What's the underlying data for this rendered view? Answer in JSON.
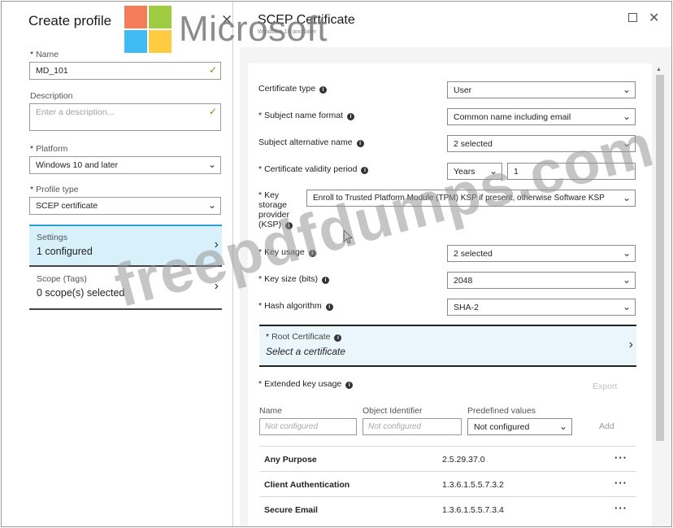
{
  "left_panel": {
    "title": "Create profile",
    "close_icon": "close-icon",
    "name": {
      "label": "Name",
      "value": "MD_101"
    },
    "description": {
      "label": "Description",
      "placeholder": "Enter a description..."
    },
    "platform": {
      "label": "Platform",
      "value": "Windows 10 and later"
    },
    "profile_type": {
      "label": "Profile type",
      "value": "SCEP certificate"
    },
    "settings": {
      "title": "Settings",
      "value": "1 configured"
    },
    "scope": {
      "title": "Scope (Tags)",
      "value": "0 scope(s) selected"
    }
  },
  "right_panel": {
    "title": "SCEP Certificate",
    "subtitle": "Windows 10 and later",
    "fields": {
      "certificate_type": {
        "label": "Certificate type",
        "value": "User"
      },
      "subject_name_format": {
        "label": "Subject name format",
        "value": "Common name including email"
      },
      "subject_alt_name": {
        "label": "Subject alternative name",
        "value": "2 selected"
      },
      "validity_period": {
        "label": "Certificate validity period",
        "unit": "Years",
        "value": "1"
      },
      "ksp": {
        "label_lines": [
          "Key",
          "storage",
          "provider",
          "(KSP)"
        ],
        "value": "Enroll to Trusted Platform Module (TPM) KSP if present, otherwise Software KSP"
      },
      "key_usage": {
        "label": "Key usage",
        "value": "2 selected"
      },
      "key_size": {
        "label": "Key size (bits)",
        "value": "2048"
      },
      "hash_algorithm": {
        "label": "Hash algorithm",
        "value": "SHA-2"
      }
    },
    "root_certificate": {
      "label": "Root Certificate",
      "value": "Select a certificate"
    },
    "eku": {
      "label": "Extended key usage",
      "export_label": "Export",
      "columns": {
        "name": "Name",
        "oid": "Object Identifier",
        "predefined": "Predefined values"
      },
      "name_placeholder": "Not configured",
      "oid_placeholder": "Not configured",
      "predefined_value": "Not configured",
      "add_label": "Add",
      "rows": [
        {
          "name": "Any Purpose",
          "oid": "2.5.29.37.0"
        },
        {
          "name": "Client Authentication",
          "oid": "1.3.6.1.5.5.7.3.2"
        },
        {
          "name": "Secure Email",
          "oid": "1.3.6.1.5.5.7.3.4"
        }
      ]
    }
  },
  "watermarks": {
    "brand": "Microsoft",
    "site": "freepdfdumps.com"
  },
  "colors": {
    "selected_bg": "#d8f0fa",
    "accent_blue": "#2aa0d8",
    "check_green": "#57a300",
    "ms_red": "#f25022",
    "ms_green": "#7fba00",
    "ms_blue": "#00a4ef",
    "ms_yellow": "#ffb900"
  }
}
